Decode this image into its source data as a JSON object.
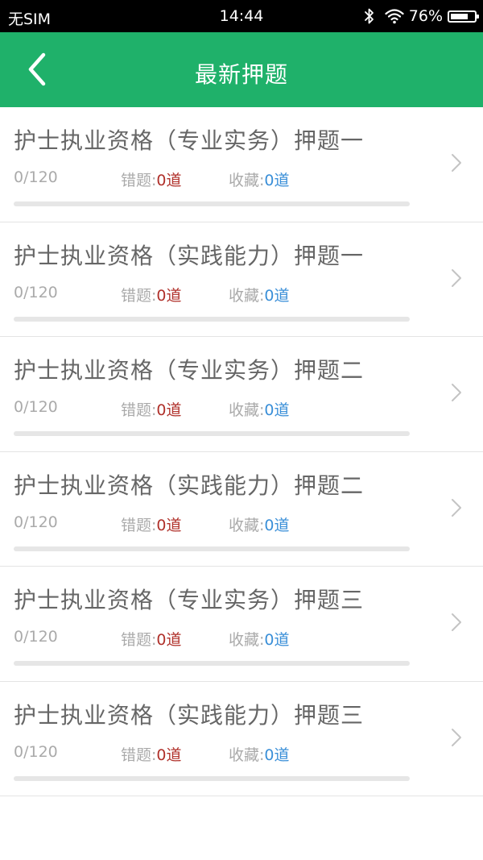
{
  "status_bar": {
    "carrier": "无SIM",
    "time": "14:44",
    "battery_percent": "76%",
    "battery_level": 0.76,
    "icons": [
      "bluetooth-icon",
      "wifi-icon",
      "battery-icon"
    ]
  },
  "header": {
    "title": "最新押题",
    "back_icon": "chevron-left-icon",
    "background_color": "#1fb16a"
  },
  "labels": {
    "wrong": "错题:",
    "favorite": "收藏:"
  },
  "colors": {
    "wrong_value": "#b0302a",
    "favorite_value": "#3a8fd8",
    "accent": "#1fb16a"
  },
  "items": [
    {
      "title": "护士执业资格（专业实务）押题一",
      "progress": "0/120",
      "progress_fraction": 0,
      "wrong": "0道",
      "favorite": "0道"
    },
    {
      "title": "护士执业资格（实践能力）押题一",
      "progress": "0/120",
      "progress_fraction": 0,
      "wrong": "0道",
      "favorite": "0道"
    },
    {
      "title": "护士执业资格（专业实务）押题二",
      "progress": "0/120",
      "progress_fraction": 0,
      "wrong": "0道",
      "favorite": "0道"
    },
    {
      "title": "护士执业资格（实践能力）押题二",
      "progress": "0/120",
      "progress_fraction": 0,
      "wrong": "0道",
      "favorite": "0道"
    },
    {
      "title": "护士执业资格（专业实务）押题三",
      "progress": "0/120",
      "progress_fraction": 0,
      "wrong": "0道",
      "favorite": "0道"
    },
    {
      "title": "护士执业资格（实践能力）押题三",
      "progress": "0/120",
      "progress_fraction": 0,
      "wrong": "0道",
      "favorite": "0道"
    }
  ]
}
